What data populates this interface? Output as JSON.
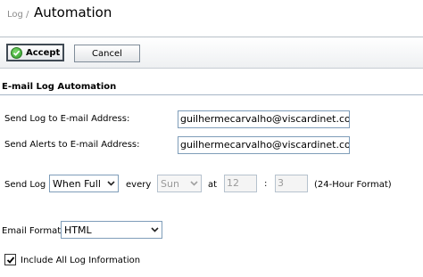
{
  "header": {
    "breadcrumb": "Log /",
    "title": "Automation"
  },
  "toolbar": {
    "accept_label": "Accept",
    "cancel_label": "Cancel"
  },
  "section": {
    "title": "E-mail Log Automation"
  },
  "form": {
    "send_log_to": {
      "label": "Send Log to E-mail Address:",
      "value": "guilhermecarvalho@viscardinet.con"
    },
    "send_alerts_to": {
      "label": "Send Alerts to E-mail Address:",
      "value": "guilhermecarvalho@viscardinet.con"
    },
    "send_log": {
      "label": "Send Log",
      "when_value": "When Full",
      "every_label": "every",
      "day_value": "Sun",
      "at_label": "at",
      "hour_value": "12",
      "colon": ":",
      "minute_value": "3",
      "format_note": "(24-Hour Format)"
    },
    "email_format": {
      "label": "Email Format:",
      "value": "HTML"
    },
    "include_all": {
      "label": "Include All Log Information",
      "checked": true
    }
  },
  "colors": {
    "accent_green": "#2f9b2b",
    "border_blue": "#7f9db9",
    "rule": "#a7b6c6"
  }
}
